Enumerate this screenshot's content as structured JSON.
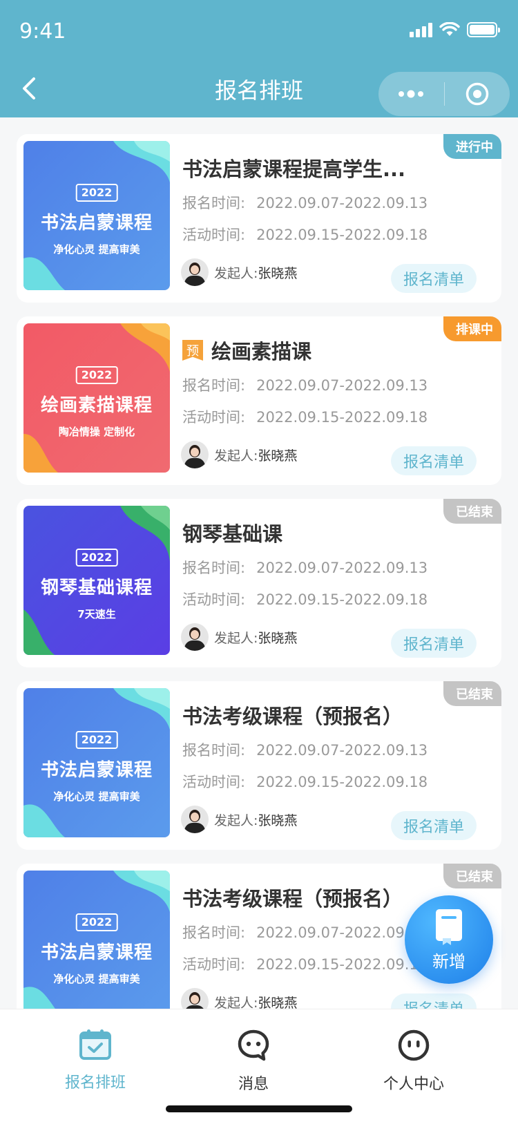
{
  "status_bar": {
    "time": "9:41"
  },
  "nav": {
    "title": "报名排班"
  },
  "labels": {
    "reg_time": "报名时间:",
    "act_time": "活动时间:",
    "initiator": "发起人:",
    "list_button": "报名清单",
    "pre_tag": "预"
  },
  "cards": [
    {
      "status": "进行中",
      "status_color": "#5fb5cd",
      "title": "书法启蒙课程提高学生...",
      "pre": false,
      "cover": {
        "year": "2022",
        "title": "书法启蒙课程",
        "subtitle": "净化心灵 提高审美",
        "theme": "blue"
      },
      "reg_time": "2022.09.07-2022.09.13",
      "act_time": "2022.09.15-2022.09.18",
      "initiator": "张晓燕"
    },
    {
      "status": "排课中",
      "status_color": "#f79a2e",
      "title": "绘画素描课",
      "pre": true,
      "cover": {
        "year": "2022",
        "title": "绘画素描课程",
        "subtitle": "陶冶情操 定制化",
        "theme": "red"
      },
      "reg_time": "2022.09.07-2022.09.13",
      "act_time": "2022.09.15-2022.09.18",
      "initiator": "张晓燕"
    },
    {
      "status": "已结束",
      "status_color": "#c4c4c4",
      "title": "钢琴基础课",
      "pre": false,
      "cover": {
        "year": "2022",
        "title": "钢琴基础课程",
        "subtitle": "7天速生",
        "theme": "purple"
      },
      "reg_time": "2022.09.07-2022.09.13",
      "act_time": "2022.09.15-2022.09.18",
      "initiator": "张晓燕"
    },
    {
      "status": "已结束",
      "status_color": "#c4c4c4",
      "title": "书法考级课程（预报名）",
      "pre": false,
      "cover": {
        "year": "2022",
        "title": "书法启蒙课程",
        "subtitle": "净化心灵 提高审美",
        "theme": "blue"
      },
      "reg_time": "2022.09.07-2022.09.13",
      "act_time": "2022.09.15-2022.09.18",
      "initiator": "张晓燕"
    },
    {
      "status": "已结束",
      "status_color": "#c4c4c4",
      "title": "书法考级课程（预报名）",
      "pre": false,
      "cover": {
        "year": "2022",
        "title": "书法启蒙课程",
        "subtitle": "净化心灵 提高审美",
        "theme": "blue"
      },
      "reg_time": "2022.09.07-2022.09.13",
      "act_time": "2022.09.15-2022.09.18",
      "initiator": "张晓燕"
    }
  ],
  "fab": {
    "label": "新增"
  },
  "tabs": [
    {
      "label": "报名排班",
      "icon": "calendar-check-icon",
      "active": true
    },
    {
      "label": "消息",
      "icon": "chat-bubble-icon",
      "active": false
    },
    {
      "label": "个人中心",
      "icon": "face-icon",
      "active": false
    }
  ],
  "colors": {
    "primary": "#5fb5cd",
    "accent_orange": "#f79a2e",
    "ended_gray": "#c4c4c4",
    "fab_blue": "#1e7fe8"
  }
}
